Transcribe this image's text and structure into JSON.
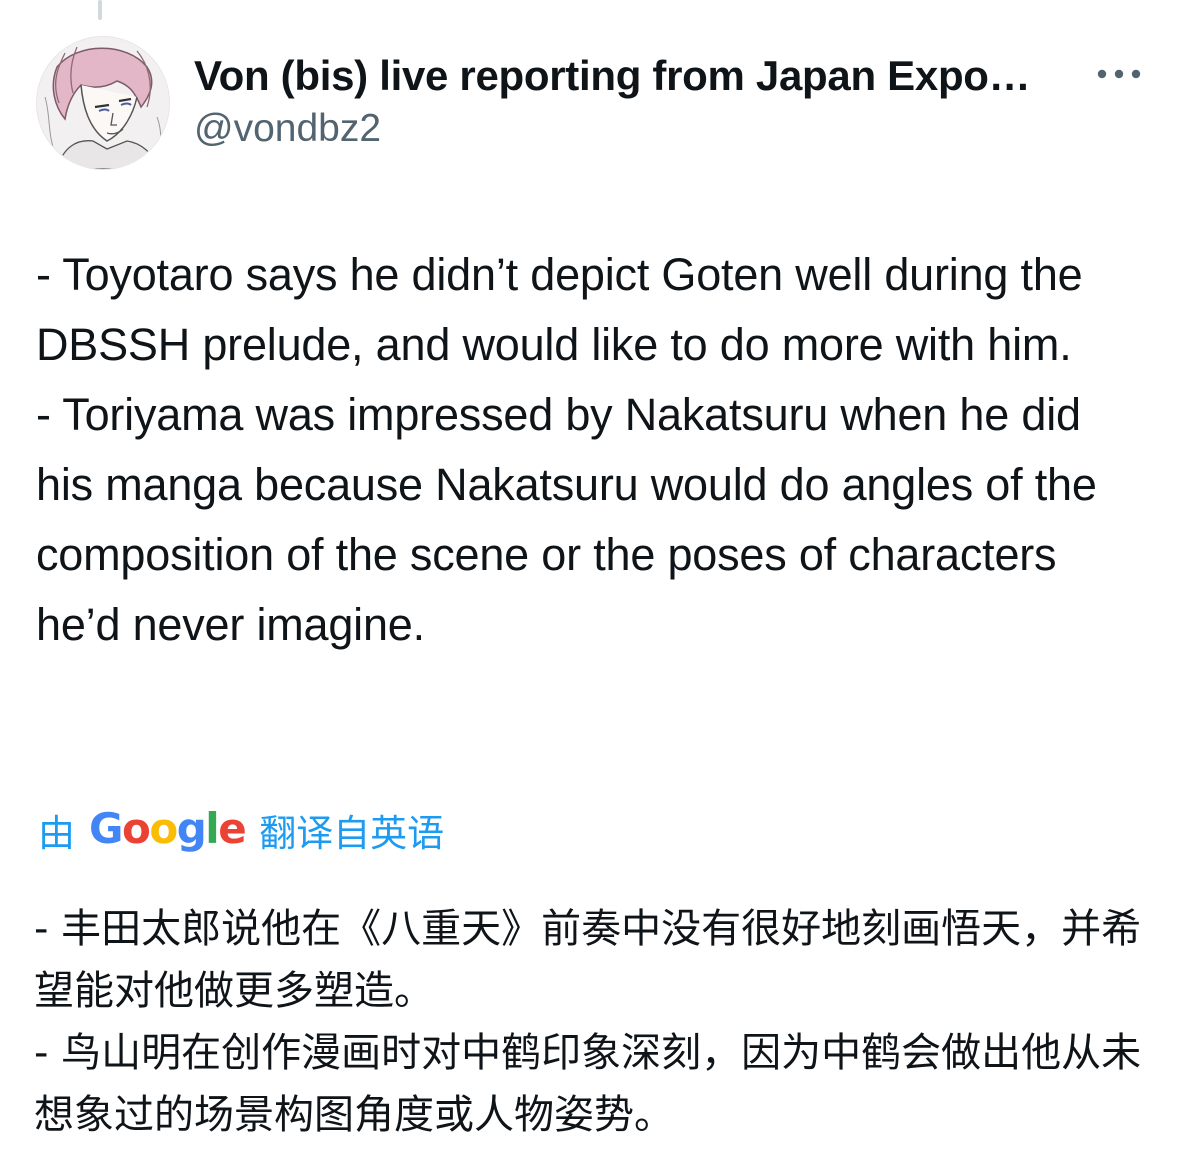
{
  "author": {
    "display_name": "Von (bis) live reporting from Japan Expo…",
    "handle": "@vondbz2",
    "avatar_icon": "avatar-illustration"
  },
  "more_icon": "more-options-icon",
  "tweet": {
    "paragraphs": [
      "- Toyotaro says he didn’t depict Goten well during the DBSSH prelude, and would like to do more with him.",
      "- Toriyama was impressed by Nakatsuru when he did his manga because Nakatsuru would do angles of the composition of the scene or the poses of characters he’d never imagine."
    ]
  },
  "translation": {
    "prefix": "由",
    "brand": "Google",
    "suffix": "翻译自英语",
    "link_color": "#1d9bf0",
    "paragraphs": [
      "- 丰田太郎说他在《八重天》前奏中没有很好地刻画悟天，并希望能对他做更多塑造。",
      "- 鸟山明在创作漫画时对中鹤印象深刻，因为中鹤会做出他从未想象过的场景构图角度或人物姿势。"
    ]
  }
}
